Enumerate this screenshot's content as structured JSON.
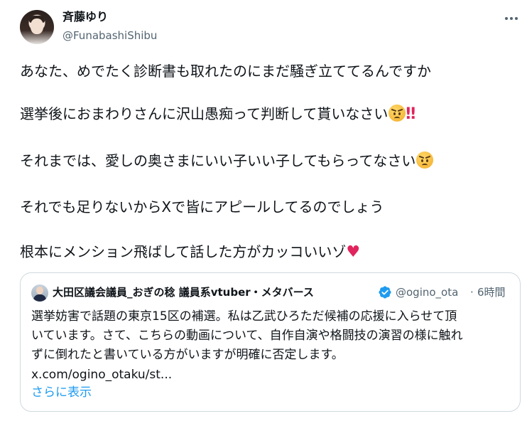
{
  "author": {
    "display_name": "斉藤ゆり",
    "handle": "@FunabashiShibu"
  },
  "tweet": {
    "line1": "あなた、めでたく診断書も取れたのにまだ騒ぎ立ててるんですか",
    "line2": "選挙後におまわりさんに沢山愚痴って判断して貰いなさい",
    "line3": "それまでは、愛しの奥さまにいい子いい子してもらってなさい",
    "line4": "それでも足りないからXで皆にアピールしてるのでしょう",
    "line5": "根本にメンション飛ばして話した方がカッコいいゾ",
    "emoji_double_exclamation": "‼",
    "emoji_heart": "♥"
  },
  "quoted": {
    "display_name": "大田区議会議員_おぎの稔 議員系vtuber・メタバース",
    "handle": "@ogino_ota",
    "separator": "·",
    "time": "6時間",
    "text_line1": "選挙妨害で話題の東京15区の補選。私は乙武ひろただ候補の応援に入らせて頂",
    "text_line2": "いています。さて、こちらの動画について、自作自演や格闘技の演習の様に触れ",
    "text_line3": "ずに倒れたと書いている方がいますが明確に否定します。",
    "link": "x.com/ogino_otaku/st...",
    "show_more": "さらに表示"
  },
  "colors": {
    "accent": "#1d9bf0",
    "secondary_text": "#536471",
    "border": "#cfd9de",
    "heart": "#e0245e"
  },
  "icons": {
    "more": "more-horizontal-icon",
    "verified": "verified-badge-icon",
    "angry": "angry-face-emoji",
    "double_exclamation": "double-exclamation-emoji",
    "heart": "heart-emoji"
  }
}
